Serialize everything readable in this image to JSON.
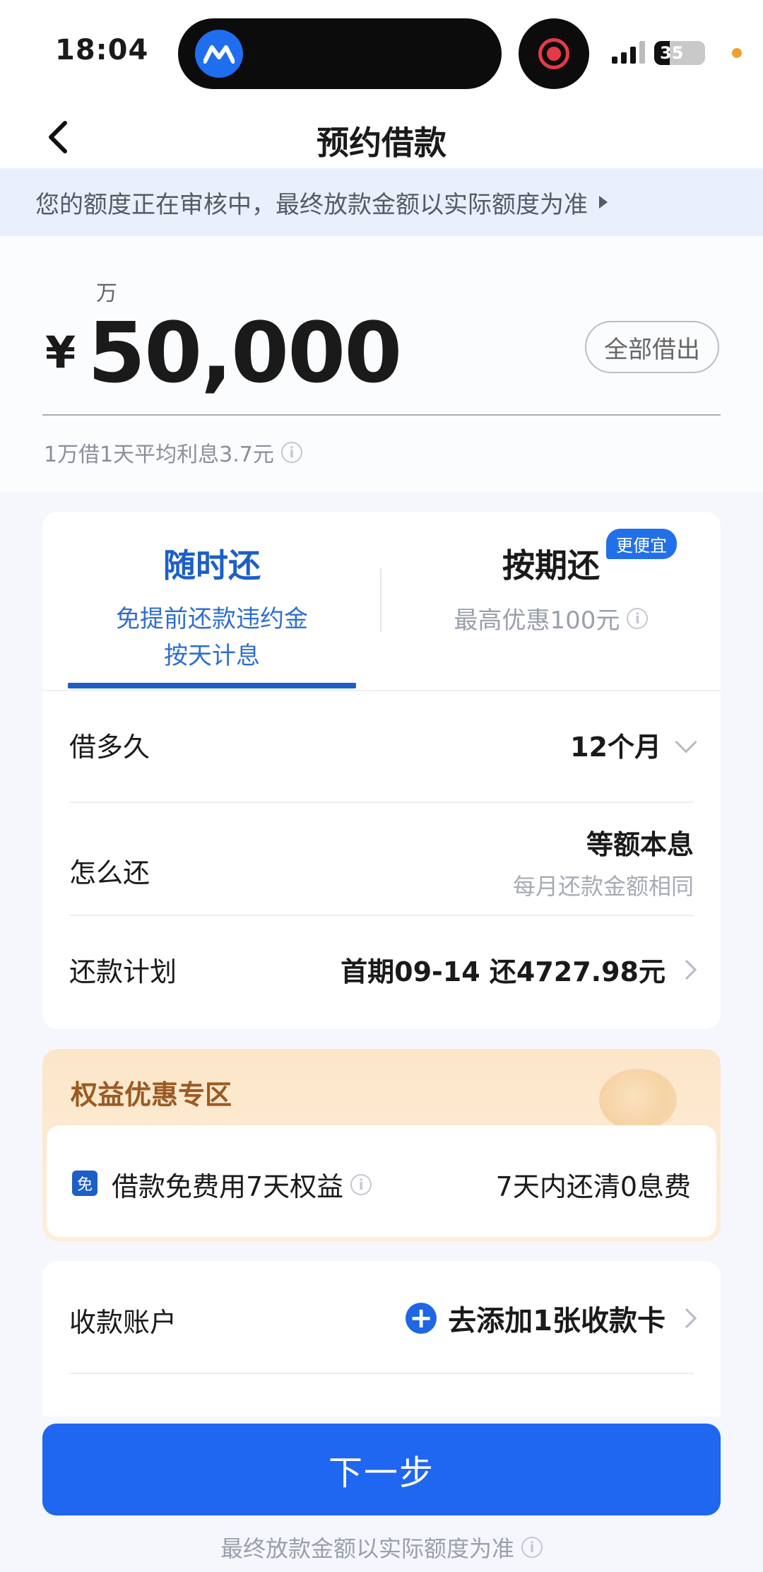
{
  "status_bar": {
    "time": "18:04",
    "battery": "35"
  },
  "nav": {
    "title": "预约借款"
  },
  "notice": {
    "text": "您的额度正在审核中，最终放款金额以实际额度为准"
  },
  "amount": {
    "unit": "万",
    "currency": "¥",
    "value": "50,000",
    "borrow_all_label": "全部借出",
    "interest_note": "1万借1天平均利息3.7元"
  },
  "repay_tabs": {
    "left": {
      "title": "随时还",
      "sub1": "免提前还款违约金",
      "sub2": "按天计息",
      "selected": true
    },
    "right": {
      "title": "按期还",
      "badge": "更便宜",
      "sub": "最高优惠100元",
      "selected": false
    }
  },
  "term": {
    "label": "借多久",
    "value": "12个月"
  },
  "method": {
    "label": "怎么还",
    "value": "等额本息",
    "sub": "每月还款金额相同"
  },
  "plan": {
    "label": "还款计划",
    "value": "首期09-14 还4727.98元"
  },
  "benefits": {
    "title": "权益优惠专区",
    "badge": "免",
    "item": "借款免费用7天权益",
    "right": "7天内还清0息费"
  },
  "account": {
    "label": "收款账户",
    "action": "去添加1张收款卡"
  },
  "next_button": "下一步",
  "footer_note": "最终放款金额以实际额度为准",
  "colors": {
    "primary": "#1f66f0",
    "tab_active": "#1d5fc7",
    "benefit_title": "#9a5a22"
  }
}
